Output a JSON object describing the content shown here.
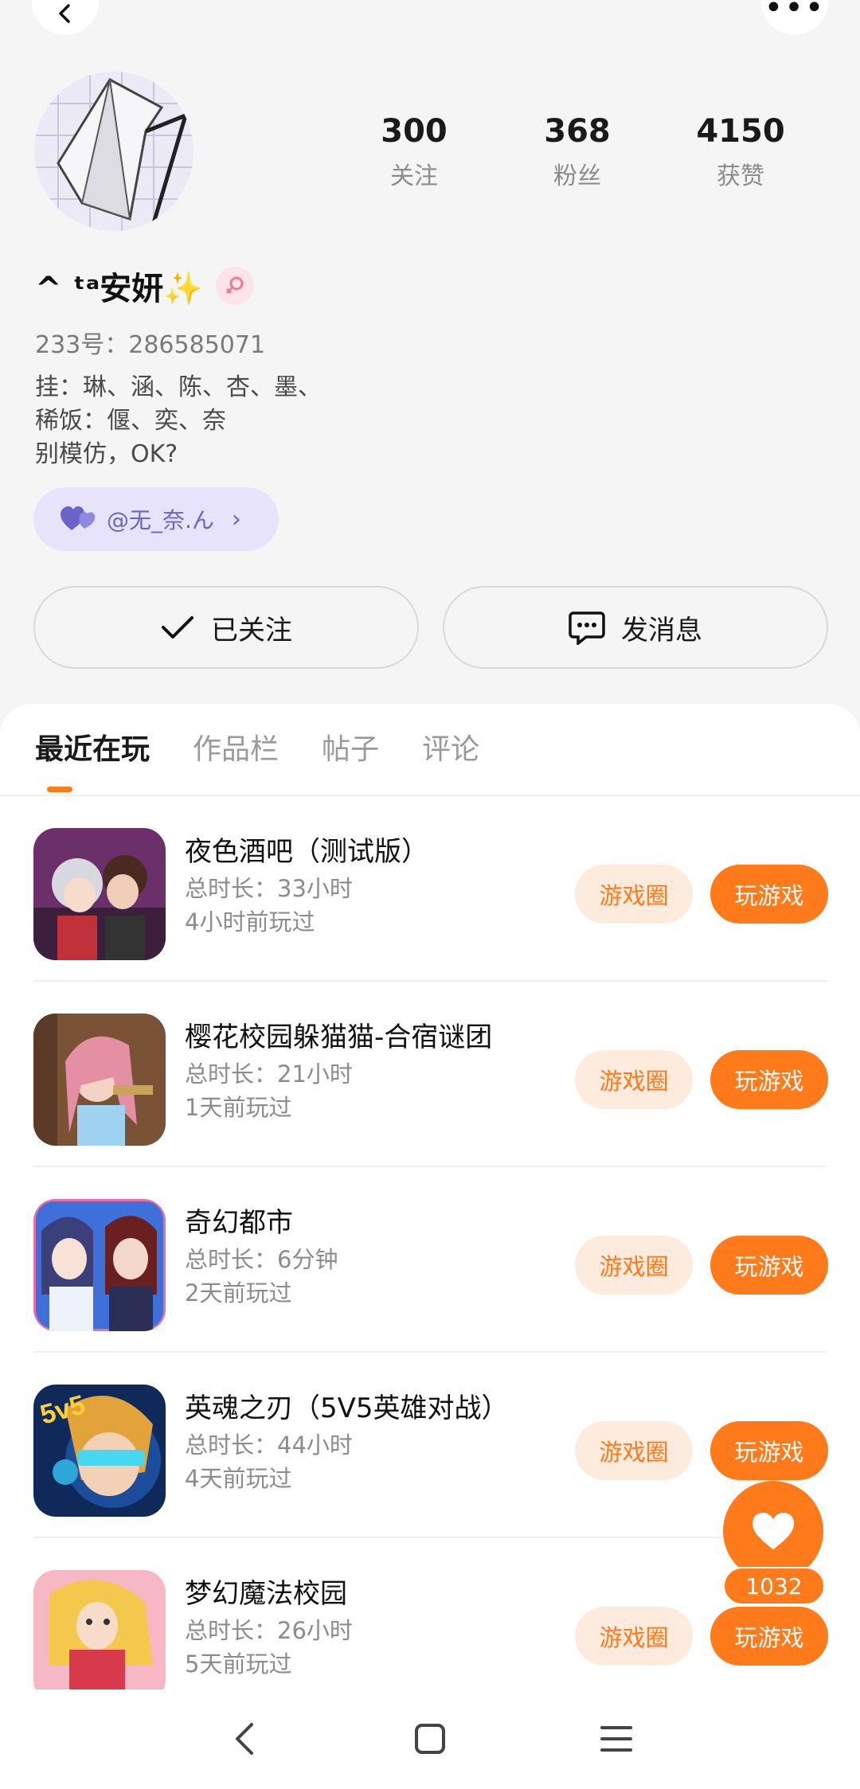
{
  "header": {
    "back_icon": "chevron-left-icon",
    "more_icon": "more-dots-icon",
    "more_label": "•••"
  },
  "profile": {
    "stats": [
      {
        "value": "300",
        "label": "关注"
      },
      {
        "value": "368",
        "label": "粉丝"
      },
      {
        "value": "4150",
        "label": "获赞"
      }
    ],
    "name": "^ ᵗᵃ安妍✨",
    "gender_icon": "female-icon",
    "uid": "233号：286585071",
    "bio": "挂：琳、涵、陈、杏、墨、\n稀饭：偃、奕、奈\n别模仿，OK?",
    "cp_label": "@无_奈.ん",
    "cp_chevron": "›"
  },
  "actions": {
    "follow_label": "已关注",
    "message_label": "发消息"
  },
  "tabs": [
    {
      "label": "最近在玩",
      "active": true
    },
    {
      "label": "作品栏",
      "active": false
    },
    {
      "label": "帖子",
      "active": false
    },
    {
      "label": "评论",
      "active": false
    }
  ],
  "games": [
    {
      "name": "夜色酒吧（测试版）",
      "duration": "总时长：33小时",
      "last_played": "4小时前玩过",
      "circle_label": "游戏圈",
      "play_label": "玩游戏"
    },
    {
      "name": "樱花校园躲猫猫-合宿谜团",
      "duration": "总时长：21小时",
      "last_played": "1天前玩过",
      "circle_label": "游戏圈",
      "play_label": "玩游戏"
    },
    {
      "name": "奇幻都市",
      "duration": "总时长：6分钟",
      "last_played": "2天前玩过",
      "circle_label": "游戏圈",
      "play_label": "玩游戏"
    },
    {
      "name": "英魂之刃（5V5英雄对战）",
      "duration": "总时长：44小时",
      "last_played": "4天前玩过",
      "circle_label": "游戏圈",
      "play_label": "玩游戏"
    },
    {
      "name": "梦幻魔法校园",
      "duration": "总时长：26小时",
      "last_played": "5天前玩过",
      "circle_label": "游戏圈",
      "play_label": "玩游戏"
    }
  ],
  "like": {
    "count": "1032"
  },
  "colors": {
    "accent": "#ff7a1a",
    "accent_soft": "#fdebdd",
    "cp_bg": "#e6e3fb",
    "cp_fg": "#6b63c8"
  }
}
